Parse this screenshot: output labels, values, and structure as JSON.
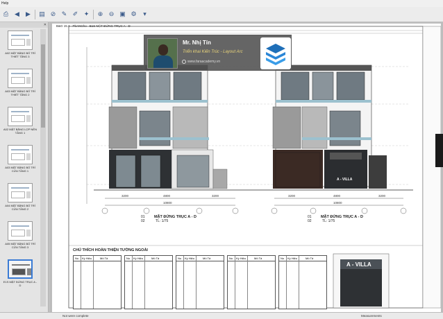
{
  "window": {
    "menu_label": "Help"
  },
  "toolbar": {
    "icons": [
      "print-icon",
      "back-icon",
      "forward-icon",
      "page-icon",
      "link-icon",
      "pen-icon",
      "highlight-icon",
      "note-icon",
      "zoom-in-icon",
      "zoom-out-icon",
      "snapshot-icon",
      "settings-icon"
    ]
  },
  "sidebar": {
    "pages": [
      {
        "label": "A02 MẶT BẰNG BỐ TRÍ THIẾT TẦNG 3"
      },
      {
        "label": "A03 MẶT BẰNG BỐ TRÍ THIẾT TẦNG 2"
      },
      {
        "label": "A02 MẶT BẰNG LỢP NỀN TẦNG 1"
      },
      {
        "label": "A03 MẶT BẰNG BỐ TRÍ CỬA TẦNG 1"
      },
      {
        "label": "A04 MẶT BẰNG BỐ TRÍ CỬA TẦNG 2"
      },
      {
        "label": "A05 MẶT BẰNG BỐ TRÍ CỬA TẦNG 3"
      },
      {
        "label": "E1S MẶT ĐỨNG TRỤC A - D"
      }
    ],
    "active_index": 6
  },
  "document": {
    "sheet_title": "B&G 15.3 · PbANGho · E1S MẶT ĐỨNG TRỤC A - D",
    "plan_left_id": "01",
    "plan_left_title": "MẶT ĐỨNG TRỤC A - D",
    "plan_left_scale": "TL: 1/75",
    "plan_left_sheet": "02",
    "plan_right_id": "01",
    "plan_right_title": "MẶT ĐỨNG TRỤC A - D",
    "plan_right_scale": "TL: 1/75",
    "plan_right_sheet": "02",
    "dims_left": [
      "3200",
      "4800",
      "3200",
      "10800"
    ],
    "dims_right": [
      "3200",
      "4800",
      "3200",
      "10800"
    ],
    "legend_title": "CHÚ THÍCH HOÀN THIỆN TƯỜNG NGOÀI",
    "legend_headers": [
      "No",
      "Ký Hiệu",
      "Mô Tả"
    ],
    "villa_sign": "A - VILLA",
    "villa_sign_detail": "A - VILLA"
  },
  "overlay": {
    "name": "Mr. Nhị Tín",
    "subtitle": "Triển khai Kiến Trúc - Layout Arc",
    "site": "www.faraacademy.vn"
  },
  "status": {
    "left": "Not were complete",
    "right": "Measurements"
  }
}
